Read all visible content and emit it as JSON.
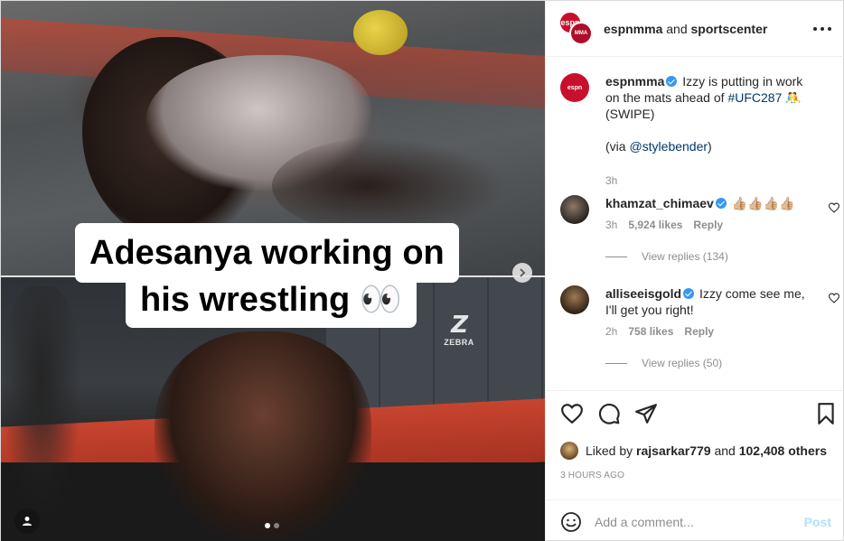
{
  "media": {
    "caption_line1": "Adesanya working on",
    "caption_line2": "his wrestling 👀",
    "wall_logo": "ZEBRA",
    "carousel_total": 2,
    "carousel_active": 1
  },
  "header": {
    "account_primary": "espnmma",
    "connector": "and",
    "account_secondary": "sportscenter",
    "avatar_label": "espn",
    "avatar_label_small": "MMA"
  },
  "post_caption": {
    "username": "espnmma",
    "text": "Izzy is putting in work on the mats ahead of",
    "hashtag": "#UFC287",
    "emoji": "🤼",
    "swipe": "(SWIPE)",
    "via_prefix": "(via",
    "via_handle": "@stylebender",
    "via_suffix": ")",
    "time": "3h"
  },
  "comments": [
    {
      "username": "khamzat_chimaev",
      "text": "👍🏼👍🏼👍🏼👍🏼",
      "time": "3h",
      "likes": "5,924 likes",
      "reply": "Reply",
      "view_replies": "View replies (134)"
    },
    {
      "username": "alliseeisgold",
      "text": "Izzy come see me, I'll get you right!",
      "time": "2h",
      "likes": "758 likes",
      "reply": "Reply",
      "view_replies": "View replies (50)"
    }
  ],
  "engagement": {
    "liked_by_prefix": "Liked by",
    "liked_by_user": "rajsarkar779",
    "and": "and",
    "others": "102,408 others",
    "timestamp": "3 HOURS AGO"
  },
  "composer": {
    "placeholder": "Add a comment...",
    "post_label": "Post"
  },
  "colors": {
    "brand_red": "#c8102e",
    "link": "#00376b",
    "verified": "#3897f0",
    "post_disabled": "#b2dffc",
    "muted": "#8e8e8e"
  },
  "icons": [
    "more-icon",
    "next-chevron-icon",
    "user-tag-icon",
    "heart-icon",
    "comment-icon",
    "share-icon",
    "bookmark-icon",
    "emoji-icon",
    "verified-icon"
  ]
}
